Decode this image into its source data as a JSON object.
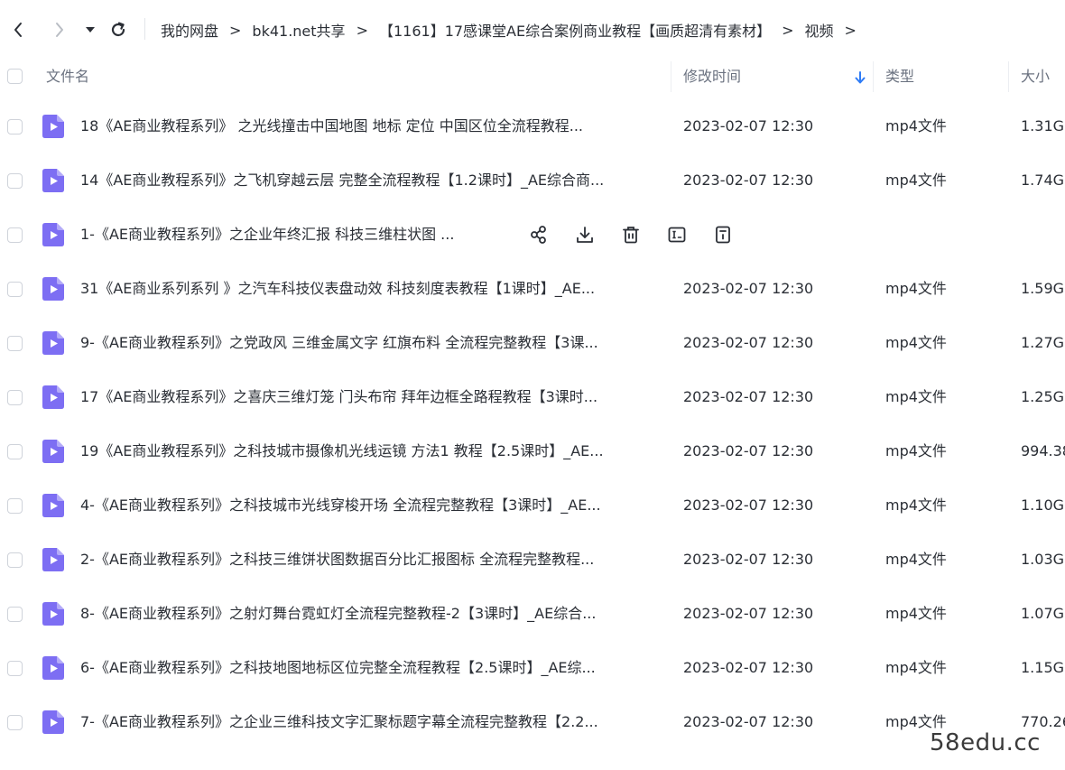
{
  "nav": {
    "icons": [
      "chevron-left-icon",
      "chevron-right-icon",
      "caret-down-icon",
      "refresh-icon"
    ]
  },
  "breadcrumb": {
    "separator": ">",
    "items": [
      "我的网盘",
      "bk41.net共享",
      "【1161】17感课堂AE综合案例商业教程【画质超清有素材】",
      "视频"
    ]
  },
  "columns": {
    "name": "文件名",
    "modified": "修改时间",
    "type": "类型",
    "size": "大小",
    "sort_icon": "sort-down-arrow-icon"
  },
  "colors": {
    "accent": "#2f7cf6",
    "file_icon": "#7d6ef3",
    "text": "#2b2f36",
    "header_text": "#6b7280"
  },
  "row_actions": [
    "share-icon",
    "download-icon",
    "delete-icon",
    "rename-icon",
    "more-info-icon"
  ],
  "files": [
    {
      "name": "18《AE商业教程系列》 之光线撞击中国地图 地标 定位  中国区位全流程教程...",
      "modified": "2023-02-07 12:30",
      "type": "mp4文件",
      "size": "1.31G"
    },
    {
      "name": "14《AE商业教程系列》之飞机穿越云层 完整全流程教程【1.2课时】_AE综合商...",
      "modified": "2023-02-07 12:30",
      "type": "mp4文件",
      "size": "1.74G"
    },
    {
      "name": "1-《AE商业教程系列》之企业年终汇报 科技三维柱状图 ...",
      "modified": "",
      "type": "",
      "size": "",
      "hover": true
    },
    {
      "name": "31《AE商业系列系列 》之汽车科技仪表盘动效 科技刻度表教程【1课时】_AE...",
      "modified": "2023-02-07 12:30",
      "type": "mp4文件",
      "size": "1.59G"
    },
    {
      "name": "9-《AE商业教程系列》之党政风 三维金属文字 红旗布料 全流程完整教程【3课...",
      "modified": "2023-02-07 12:30",
      "type": "mp4文件",
      "size": "1.27G"
    },
    {
      "name": "17《AE商业教程系列》之喜庆三维灯笼 门头布帘 拜年边框全路程教程【3课时...",
      "modified": "2023-02-07 12:30",
      "type": "mp4文件",
      "size": "1.25G"
    },
    {
      "name": "19《AE商业教程系列》之科技城市摄像机光线运镜 方法1 教程【2.5课时】_AE...",
      "modified": "2023-02-07 12:30",
      "type": "mp4文件",
      "size": "994.38"
    },
    {
      "name": "4-《AE商业教程系列》之科技城市光线穿梭开场 全流程完整教程【3课时】_AE...",
      "modified": "2023-02-07 12:30",
      "type": "mp4文件",
      "size": "1.10G"
    },
    {
      "name": "2-《AE商业教程系列》之科技三维饼状图数据百分比汇报图标 全流程完整教程...",
      "modified": "2023-02-07 12:30",
      "type": "mp4文件",
      "size": "1.03G"
    },
    {
      "name": "8-《AE商业教程系列》之射灯舞台霓虹灯全流程完整教程-2【3课时】_AE综合...",
      "modified": "2023-02-07 12:30",
      "type": "mp4文件",
      "size": "1.07G"
    },
    {
      "name": "6-《AE商业教程系列》之科技地图地标区位完整全流程教程【2.5课时】_AE综...",
      "modified": "2023-02-07 12:30",
      "type": "mp4文件",
      "size": "1.15G"
    },
    {
      "name": "7-《AE商业教程系列》之企业三维科技文字汇聚标题字幕全流程完整教程【2.2...",
      "modified": "2023-02-07 12:30",
      "type": "mp4文件",
      "size": "770.26"
    }
  ],
  "watermark": "58edu.cc"
}
